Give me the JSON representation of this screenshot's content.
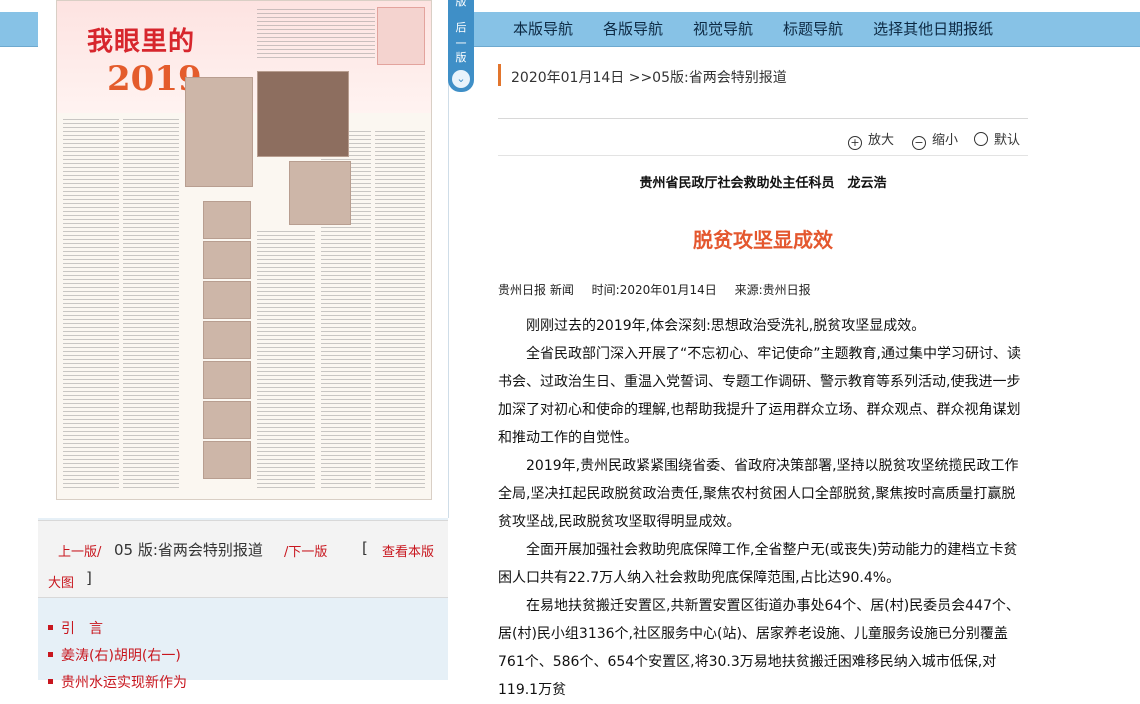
{
  "top_nav": {
    "items": [
      "本版导航",
      "各版导航",
      "视觉导航",
      "标题导航",
      "选择其他日期报纸"
    ]
  },
  "side_tab": {
    "chars": [
      "版",
      "后",
      "一",
      "版"
    ],
    "arrow": "⌄"
  },
  "newspaper_thumb": {
    "title": "我眼里的",
    "year": "2019"
  },
  "page_nav": {
    "prev": "上一版/",
    "current": "05 版:省两会特别报道",
    "next": "/下一版",
    "bracket_open": "[",
    "view_large_a": "查看本版",
    "view_large_b": "大图",
    "bracket_close": "]"
  },
  "article_list": [
    "引　言",
    "姜涛(右)胡明(右一)",
    "贵州水运实现新作为"
  ],
  "breadcrumb": "2020年01月14日  >>05版:省两会特别报道",
  "toolbar": {
    "zoom_in": "放大",
    "zoom_out": "缩小",
    "default": "默认"
  },
  "article": {
    "author": "贵州省民政厅社会救助处主任科员　龙云浩",
    "headline": "脱贫攻坚显成效",
    "source_paper": "贵州日报 新闻",
    "time": "时间:2020年01月14日",
    "source": "来源:贵州日报",
    "paragraphs": [
      "刚刚过去的2019年,体会深刻:思想政治受洗礼,脱贫攻坚显成效。",
      "全省民政部门深入开展了“不忘初心、牢记使命”主题教育,通过集中学习研讨、读书会、过政治生日、重温入党誓词、专题工作调研、警示教育等系列活动,使我进一步加深了对初心和使命的理解,也帮助我提升了运用群众立场、群众观点、群众视角谋划和推动工作的自觉性。",
      "2019年,贵州民政紧紧围绕省委、省政府决策部署,坚持以脱贫攻坚统揽民政工作全局,坚决扛起民政脱贫政治责任,聚焦农村贫困人口全部脱贫,聚焦按时高质量打赢脱贫攻坚战,民政脱贫攻坚取得明显成效。",
      "全面开展加强社会救助兜底保障工作,全省整户无(或丧失)劳动能力的建档立卡贫困人口共有22.7万人纳入社会救助兜底保障范围,占比达90.4%。",
      "在易地扶贫搬迁安置区,共新置安置区街道办事处64个、居(村)民委员会447个、居(村)民小组3136个,社区服务中心(站)、居家养老设施、儿童服务设施已分别覆盖761个、586个、654个安置区,将30.3万易地扶贫搬迁困难移民纳入城市低保,对119.1万贫"
    ]
  }
}
